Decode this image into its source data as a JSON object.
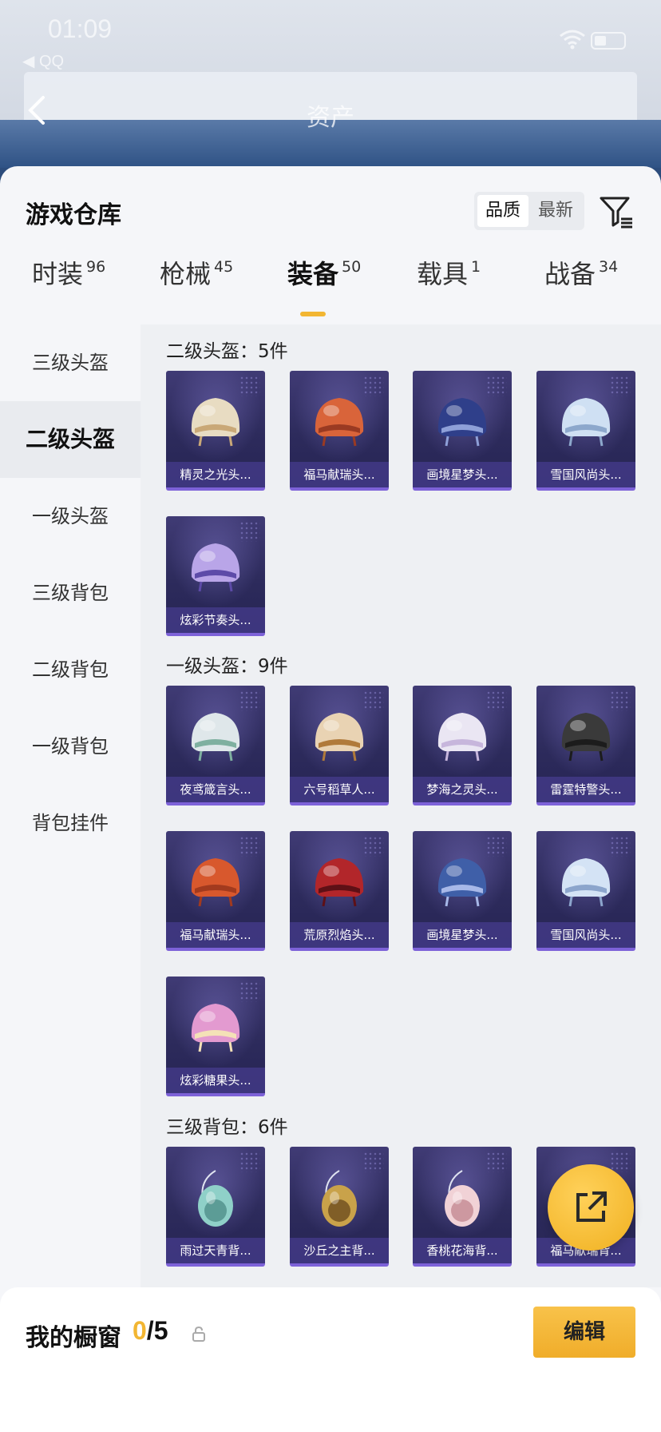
{
  "status_bar": {
    "time": "01:09",
    "app": "◀ QQ"
  },
  "nav": {
    "title": "资产"
  },
  "sheet": {
    "title": "游戏仓库",
    "sort": {
      "quality": "品质",
      "newest": "最新"
    }
  },
  "tabs": [
    {
      "label": "时装",
      "count": "96"
    },
    {
      "label": "枪械",
      "count": "45"
    },
    {
      "label": "装备",
      "count": "50"
    },
    {
      "label": "载具",
      "count": "1"
    },
    {
      "label": "战备",
      "count": "34"
    }
  ],
  "sidebar": [
    {
      "label": "三级头盔"
    },
    {
      "label": "二级头盔"
    },
    {
      "label": "一级头盔"
    },
    {
      "label": "三级背包"
    },
    {
      "label": "二级背包"
    },
    {
      "label": "一级背包"
    },
    {
      "label": "背包挂件"
    }
  ],
  "sections": [
    {
      "title": "二级头盔：5件",
      "items": [
        "精灵之光头...",
        "福马献瑞头...",
        "画境星梦头...",
        "雪国风尚头...",
        "炫彩节奏头..."
      ]
    },
    {
      "title": "一级头盔：9件",
      "items": [
        "夜鸢箴言头...",
        "六号稻草人...",
        "梦海之灵头...",
        "雷霆特警头...",
        "福马献瑞头...",
        "荒原烈焰头...",
        "画境星梦头...",
        "雪国风尚头...",
        "炫彩糖果头..."
      ]
    },
    {
      "title": "三级背包：6件",
      "items": [
        "雨过天青背...",
        "沙丘之主背...",
        "香桃花海背...",
        "福马献瑞背..."
      ]
    }
  ],
  "item_colors": {
    "0": [
      "#e8dcc2",
      "#c9a877"
    ],
    "1": [
      "#d9643a",
      "#9a3a22"
    ],
    "2": [
      "#2f3f8a",
      "#8ea0d8"
    ],
    "3": [
      "#cfe0f3",
      "#8da8cc"
    ],
    "4": [
      "#b9a5e8",
      "#5d4ba8"
    ],
    "5": [
      "#dfe7ea",
      "#7fb0a0"
    ],
    "6": [
      "#e9d3b3",
      "#b07a3a"
    ],
    "7": [
      "#eae6f3",
      "#c7b6dc"
    ],
    "8": [
      "#3a3a3a",
      "#1c1c1c"
    ],
    "9": [
      "#d8582d",
      "#a23a1e"
    ],
    "10": [
      "#b2262a",
      "#5e1016"
    ],
    "11": [
      "#3f5fa8",
      "#a7b8e8"
    ],
    "12": [
      "#d4e3f5",
      "#8ca5cc"
    ],
    "13": [
      "#e39ad0",
      "#f4e1b7"
    ],
    "14": [
      "#8fd0c8",
      "#4f8f8a"
    ],
    "15": [
      "#c9a24a",
      "#6e4e1e"
    ],
    "16": [
      "#f1d2d6",
      "#c48a92"
    ],
    "17": [
      "#d9643a",
      "#8a3a1e"
    ]
  },
  "bottom": {
    "label": "我的橱窗",
    "current": "0",
    "total": "/5",
    "edit": "编辑"
  },
  "colors": {
    "accent": "#f2b632",
    "card_bg": "#2d2b5c",
    "card_border": "#7d62d8"
  }
}
